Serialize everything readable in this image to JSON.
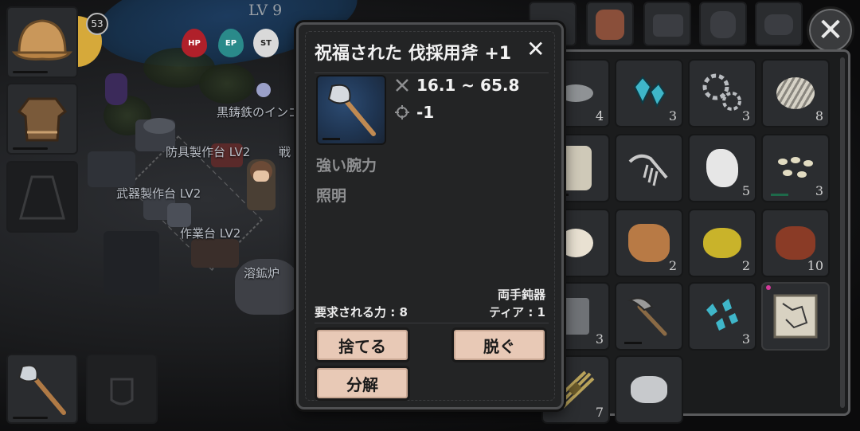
{
  "hud": {
    "level": "LV 9",
    "badge_count": "53",
    "stats": [
      "HP",
      "EP",
      "ST"
    ]
  },
  "world_labels": {
    "cast_iron_ingot": "黒鋳鉄のインゴット",
    "armor_workbench": "防具製作台 LV2",
    "battle": "戦",
    "weapon_workbench": "武器製作台 LV2",
    "workbench": "作業台 LV2",
    "smelter": "溶鉱炉"
  },
  "popup": {
    "title": "祝福された 伐採用斧 +1",
    "close_glyph": "✕",
    "damage": "16.1 ~ 65.8",
    "accuracy": "-1",
    "attributes": [
      "強い腕力",
      "照明"
    ],
    "weapon_type": "両手鈍器",
    "required_strength": "要求される力 : 8",
    "tier": "ティア : 1",
    "buttons": {
      "discard": "捨てる",
      "unequip": "脱ぐ",
      "disassemble": "分解"
    }
  },
  "inventory": {
    "close_glyph": "✕",
    "items": [
      {
        "name": "stone",
        "count": "4"
      },
      {
        "name": "blue-crystal",
        "count": "3"
      },
      {
        "name": "gear",
        "count": "3"
      },
      {
        "name": "bandage-ball",
        "count": "8"
      },
      {
        "name": "bone-armor",
        "count": ""
      },
      {
        "name": "fossil-bones",
        "count": ""
      },
      {
        "name": "white-rock",
        "count": "5"
      },
      {
        "name": "seeds",
        "count": "3"
      },
      {
        "name": "bread",
        "count": ""
      },
      {
        "name": "leather-hide",
        "count": "2"
      },
      {
        "name": "sulfur",
        "count": "2"
      },
      {
        "name": "copper-ore",
        "count": "10"
      },
      {
        "name": "iron-bar",
        "count": "3"
      },
      {
        "name": "pickaxe",
        "count": ""
      },
      {
        "name": "blue-gem-shards",
        "count": "3"
      },
      {
        "name": "star-map",
        "count": ""
      },
      {
        "name": "straw-bundle",
        "count": "7"
      },
      {
        "name": "silver-ore",
        "count": ""
      }
    ]
  },
  "colors": {
    "button_bg": "#e8c9b6",
    "popup_bg": "#232425",
    "hp": "#b0202a",
    "ep": "#2a8a8a"
  }
}
